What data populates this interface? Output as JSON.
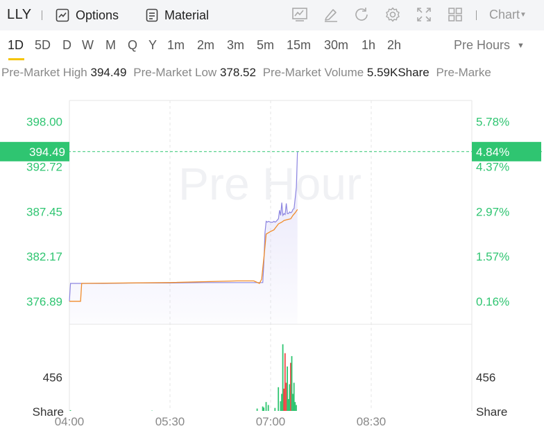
{
  "toolbar": {
    "ticker": "LLY",
    "options_label": "Options",
    "material_label": "Material",
    "chart_menu_label": "Chart"
  },
  "periods": [
    "1D",
    "5D",
    "D",
    "W",
    "M",
    "Q",
    "Y",
    "1m",
    "2m",
    "3m",
    "5m",
    "15m",
    "30m",
    "1h",
    "2h"
  ],
  "active_period": "1D",
  "session_select": "Pre Hours",
  "stats": {
    "high_label": "Pre-Market High",
    "high_value": "394.49",
    "low_label": "Pre-Market Low",
    "low_value": "378.52",
    "volume_label": "Pre-Market Volume",
    "volume_value": "5.59KShare",
    "trailing_label": "Pre-Marke"
  },
  "watermark": "Pre Hour",
  "colors": {
    "up": "#2fc571",
    "down": "#f04848",
    "price_line": "#8c85e0",
    "avg_line": "#f08c2a",
    "grid": "#e6e6e6"
  },
  "chart_data": {
    "type": "line",
    "x_ticks": [
      "04:00",
      "05:30",
      "07:00",
      "08:30"
    ],
    "y_ticks_left": [
      "398.00",
      "392.72",
      "387.45",
      "382.17",
      "376.89"
    ],
    "y_ticks_right": [
      "5.78%",
      "4.37%",
      "2.97%",
      "1.57%",
      "0.16%"
    ],
    "current_price": "394.49",
    "current_change": "4.84%",
    "volume_tick": "456",
    "volume_unit": "Share",
    "price_series": {
      "x": [
        "04:00",
        "04:01",
        "04:30",
        "05:00",
        "05:30",
        "06:00",
        "06:30",
        "06:42",
        "06:46",
        "06:53",
        "06:54",
        "06:55",
        "06:56",
        "06:57",
        "06:58",
        "07:00",
        "07:02",
        "07:03",
        "07:04",
        "07:05",
        "07:07",
        "07:08",
        "07:09",
        "07:10",
        "07:11",
        "07:12",
        "07:13",
        "07:14",
        "07:15",
        "07:16",
        "07:17",
        "07:18",
        "07:19",
        "07:20",
        "07:21",
        "07:22",
        "07:23",
        "07:24"
      ],
      "y": [
        376.9,
        379.0,
        379.0,
        379.05,
        379.05,
        379.1,
        379.1,
        379.1,
        379.1,
        379.1,
        381.5,
        385.0,
        386.3,
        386.2,
        386.3,
        386.2,
        386.2,
        386.3,
        386.2,
        386.3,
        386.6,
        387.6,
        387.0,
        388.5,
        387.0,
        387.2,
        387.1,
        388.4,
        387.2,
        387.2,
        387.4,
        387.3,
        387.4,
        387.7,
        387.8,
        389.0,
        390.3,
        394.49
      ]
    },
    "avg_series": {
      "x": [
        "04:00",
        "04:10",
        "04:11",
        "05:30",
        "06:30",
        "06:45",
        "06:50",
        "06:52",
        "06:54",
        "06:56",
        "07:00",
        "07:03",
        "07:07",
        "07:10",
        "07:12",
        "07:15",
        "07:18",
        "07:20",
        "07:22",
        "07:24"
      ],
      "y": [
        376.9,
        376.9,
        379.0,
        379.1,
        379.3,
        379.3,
        379.0,
        379.5,
        382.0,
        384.8,
        385.1,
        385.3,
        386.0,
        386.2,
        386.4,
        386.5,
        386.6,
        387.0,
        387.3,
        387.7
      ]
    },
    "volume_bars": [
      {
        "t": "04:01",
        "v": 10,
        "dir": "up"
      },
      {
        "t": "05:14",
        "v": 4,
        "dir": "up"
      },
      {
        "t": "06:48",
        "v": 32,
        "dir": "up"
      },
      {
        "t": "06:53",
        "v": 60,
        "dir": "up"
      },
      {
        "t": "06:54",
        "v": 45,
        "dir": "up"
      },
      {
        "t": "06:56",
        "v": 120,
        "dir": "up"
      },
      {
        "t": "06:58",
        "v": 80,
        "dir": "up"
      },
      {
        "t": "07:04",
        "v": 40,
        "dir": "up"
      },
      {
        "t": "07:07",
        "v": 320,
        "dir": "up"
      },
      {
        "t": "07:09",
        "v": 130,
        "dir": "up"
      },
      {
        "t": "07:10",
        "v": 230,
        "dir": "up"
      },
      {
        "t": "07:11",
        "v": 900,
        "dir": "up"
      },
      {
        "t": "07:12",
        "v": 300,
        "dir": "down"
      },
      {
        "t": "07:13",
        "v": 780,
        "dir": "down"
      },
      {
        "t": "07:14",
        "v": 380,
        "dir": "down"
      },
      {
        "t": "07:15",
        "v": 600,
        "dir": "up"
      },
      {
        "t": "07:16",
        "v": 160,
        "dir": "up"
      },
      {
        "t": "07:17",
        "v": 360,
        "dir": "up"
      },
      {
        "t": "07:18",
        "v": 650,
        "dir": "down"
      },
      {
        "t": "07:19",
        "v": 740,
        "dir": "up"
      },
      {
        "t": "07:20",
        "v": 230,
        "dir": "up"
      },
      {
        "t": "07:21",
        "v": 380,
        "dir": "up"
      },
      {
        "t": "07:22",
        "v": 120,
        "dir": "up"
      },
      {
        "t": "07:23",
        "v": 80,
        "dir": "up"
      }
    ]
  }
}
